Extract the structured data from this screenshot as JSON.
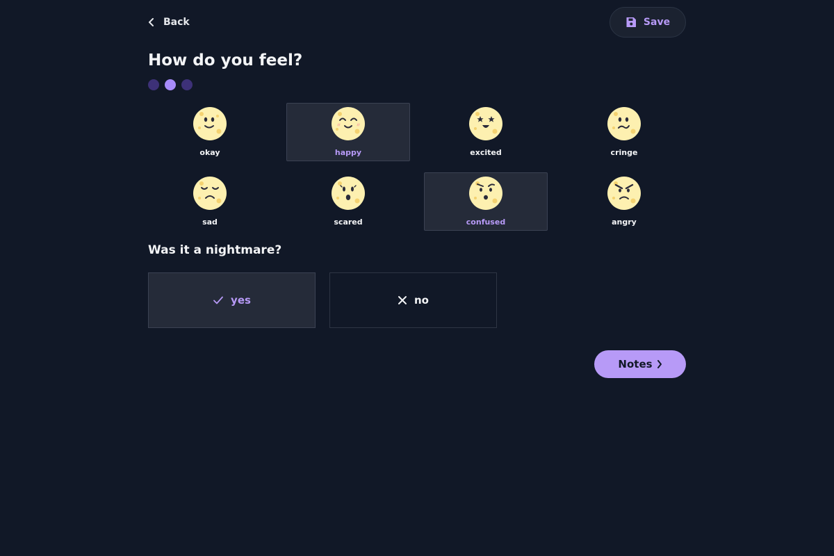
{
  "nav": {
    "back_label": "Back",
    "back_icon": "chevron-left-icon"
  },
  "toolbar": {
    "save_label": "Save",
    "save_icon": "floppy-disk-icon",
    "accent": "#b79af7"
  },
  "page": {
    "title": "How do you feel?"
  },
  "stepper": {
    "total": 3,
    "current": 2
  },
  "moods": [
    {
      "label": "okay",
      "selected": false
    },
    {
      "label": "happy",
      "selected": true
    },
    {
      "label": "excited",
      "selected": false
    },
    {
      "label": "cringe",
      "selected": false
    },
    {
      "label": "sad",
      "selected": false
    },
    {
      "label": "scared",
      "selected": false
    },
    {
      "label": "confused",
      "selected": true
    },
    {
      "label": "angry",
      "selected": false
    }
  ],
  "nightmare": {
    "question": "Was it a nightmare?",
    "yes_label": "yes",
    "no_label": "no",
    "selected": "yes"
  },
  "footer": {
    "next_label": "Notes",
    "next_icon": "chevron-right-icon"
  },
  "colors": {
    "background": "#111827",
    "accent": "#a78bfa",
    "face": "#fdf0b0"
  }
}
